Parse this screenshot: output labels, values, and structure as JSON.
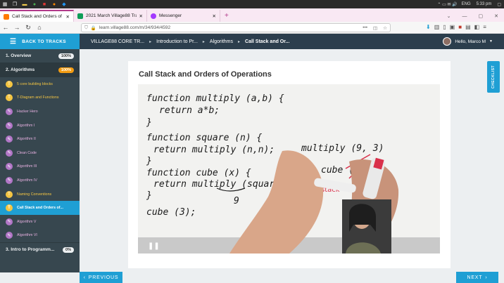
{
  "taskbar": {
    "lang": "ENG",
    "time": "5:33 pm"
  },
  "browser": {
    "tabs": [
      {
        "label": "Call Stack and Orders of Op...",
        "color": "#ff7a00",
        "active": true
      },
      {
        "label": "2021 March Village88 Training...",
        "color": "#0f9d58",
        "active": false
      },
      {
        "label": "Messenger",
        "color": "#a33aff",
        "active": false
      }
    ],
    "new_tab": "+",
    "url": "learn.village88.com/m/34/934/4592"
  },
  "header": {
    "back_label": "BACK TO TRACKS",
    "breadcrumbs": [
      "VILLAGE88 CORE TR...",
      "Introduction to Pr...",
      "Algorithms",
      "Call Stack and Or..."
    ],
    "greeting": "Hello, Marco M"
  },
  "sidebar": {
    "sections": [
      {
        "label": "1. Overview",
        "badge": "100%",
        "badge_color": "light"
      },
      {
        "label": "2. Algorithms",
        "badge": "100%",
        "badge_color": "orange"
      }
    ],
    "items": [
      {
        "label": "5 core building blocks",
        "kind": "y",
        "icon": "T"
      },
      {
        "label": "T-Diagram and Functions",
        "kind": "y",
        "icon": "T"
      },
      {
        "label": "Hacker Hero",
        "kind": "p",
        "icon": "pen"
      },
      {
        "label": "Algorithm I",
        "kind": "p",
        "icon": "pen"
      },
      {
        "label": "Algorithm II",
        "kind": "p",
        "icon": "pen"
      },
      {
        "label": "Clean Code",
        "kind": "p",
        "icon": "pen"
      },
      {
        "label": "Algorithm III",
        "kind": "p",
        "icon": "pen"
      },
      {
        "label": "Algorithm IV",
        "kind": "p",
        "icon": "pen"
      },
      {
        "label": "Naming Conventions",
        "kind": "y",
        "icon": "T"
      },
      {
        "label": "Call Stack and Orders of...",
        "kind": "active",
        "icon": "T"
      },
      {
        "label": "Algorithm V",
        "kind": "p",
        "icon": "pen"
      },
      {
        "label": "Algorithm VI",
        "kind": "p",
        "icon": "pen"
      }
    ],
    "footer_section": {
      "label": "3. Intro to Programm...",
      "badge": "0%"
    }
  },
  "lesson": {
    "title": "Call Stack and Orders of Operations",
    "video_lines": [
      "function multiply (a,b) {",
      "return a*b;",
      "}",
      "function square (n) {",
      "return multiply (n,n);",
      "}",
      "function cube (x) {",
      "return multiply (square(x), x",
      "}",
      "cube (3);"
    ],
    "board_right": [
      "multiply (9, 3)",
      "cube (3)",
      "stack"
    ],
    "annot_9": "9"
  },
  "checklist": "CHECKLIST",
  "nav": {
    "prev": "PREVIOUS",
    "next": "NEXT"
  }
}
